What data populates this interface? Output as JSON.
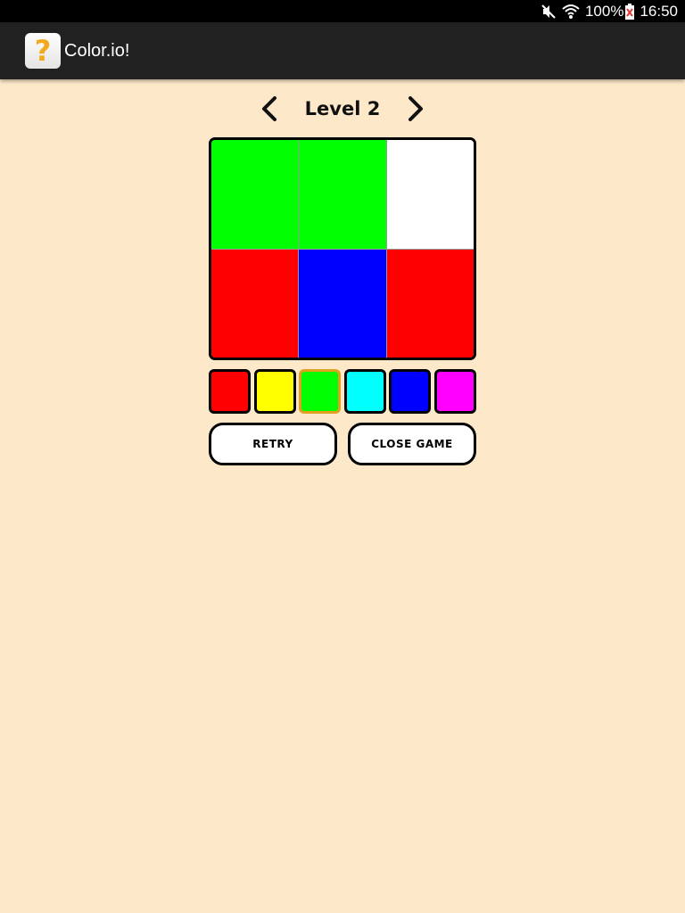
{
  "status_bar": {
    "battery": "100%",
    "time": "16:50",
    "icons": [
      "mute-icon",
      "wifi-icon",
      "battery-icon"
    ]
  },
  "app_bar": {
    "icon_glyph": "?",
    "title": "Color.io!"
  },
  "level": {
    "title": "Level 2",
    "prev_icon": "chevron-left-icon",
    "next_icon": "chevron-right-icon"
  },
  "board": {
    "rows": 2,
    "cols": 3,
    "cells": [
      "#00ff00",
      "#00ff00",
      "#ffffff",
      "#ff0000",
      "#0000ff",
      "#ff0000"
    ]
  },
  "palette": {
    "colors": [
      "#ff0000",
      "#ffff00",
      "#00ff00",
      "#00ffff",
      "#0000ff",
      "#ff00ff"
    ],
    "selected_index": 2,
    "selected_border": "#e0a020"
  },
  "buttons": {
    "retry_label": "RETRY",
    "close_label": "CLOSE GAME"
  },
  "colors": {
    "background": "#fde8c9",
    "app_bar": "#212121",
    "status_bar": "#000000",
    "app_icon_glyph": "#f2a91d"
  }
}
